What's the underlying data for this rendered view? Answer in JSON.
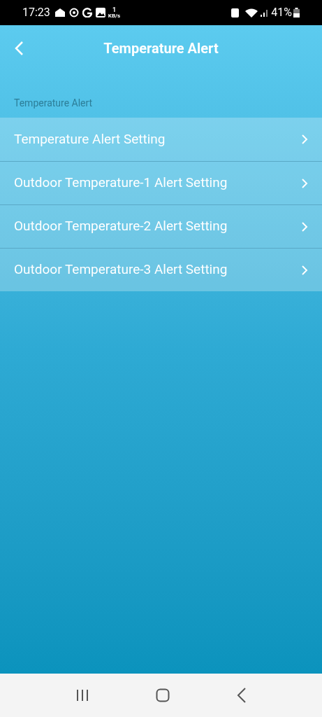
{
  "status_bar": {
    "time": "17:23",
    "speed_value": "1",
    "speed_unit": "KB/s",
    "battery": "41%"
  },
  "header": {
    "title": "Temperature Alert"
  },
  "section": {
    "label": "Temperature Alert",
    "items": [
      {
        "label": "Temperature Alert Setting"
      },
      {
        "label": "Outdoor Temperature-1 Alert Setting"
      },
      {
        "label": "Outdoor Temperature-2 Alert Setting"
      },
      {
        "label": "Outdoor Temperature-3 Alert Setting"
      }
    ]
  }
}
